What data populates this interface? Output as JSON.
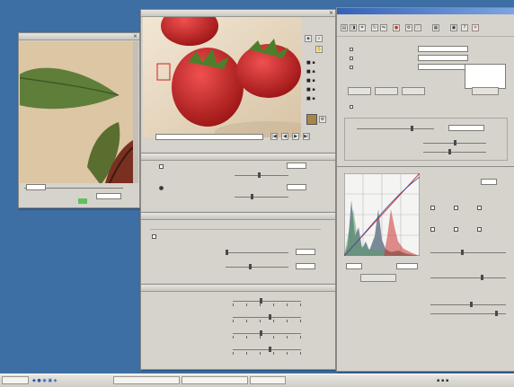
{
  "preview": {
    "zoom_value": "",
    "status_label": "",
    "status_value": ""
  },
  "photo": {
    "path_field": ""
  },
  "adjust1": {
    "row1_label": "",
    "row1_value": "",
    "row2_label": "",
    "row2_value": ""
  },
  "adjust2": {
    "title": "",
    "check_label": "",
    "row1_label": "",
    "row1_value": "",
    "row2_label": "",
    "row2_value": ""
  },
  "levels": {
    "rows": [
      "",
      "",
      "",
      ""
    ]
  },
  "scanner": {
    "menu": [
      "",
      "",
      "",
      "",
      ""
    ],
    "section1_title": "",
    "fields": [
      {
        "label": "",
        "value": ""
      },
      {
        "label": "",
        "value": ""
      },
      {
        "label": "",
        "value": ""
      }
    ],
    "buttons": [
      "",
      "",
      ""
    ],
    "right_button": "",
    "check_label": "",
    "group_label": "",
    "row_label": "",
    "small_labels": [
      "",
      ""
    ],
    "hist_in_left": "",
    "hist_in_right": "",
    "reset_button": "",
    "right_panel": {
      "label1": "",
      "value1": "",
      "label2": "",
      "label3": "",
      "label4": "",
      "label5": "",
      "label6": ""
    }
  },
  "taskbar": {
    "start_label": "",
    "items": [
      "",
      "",
      ""
    ],
    "clock": ""
  },
  "colors": {
    "desktop": "#3d6fa5",
    "window_face": "#d6d3cc",
    "histogram_fill": "#7a8a99",
    "curve_red": "#cc3333",
    "status_green": "#5fc05f"
  },
  "icons": [
    "strawberry-photo",
    "leaf-photo",
    "histogram",
    "eyedropper-icon",
    "zoom-icon",
    "gear-icon"
  ]
}
